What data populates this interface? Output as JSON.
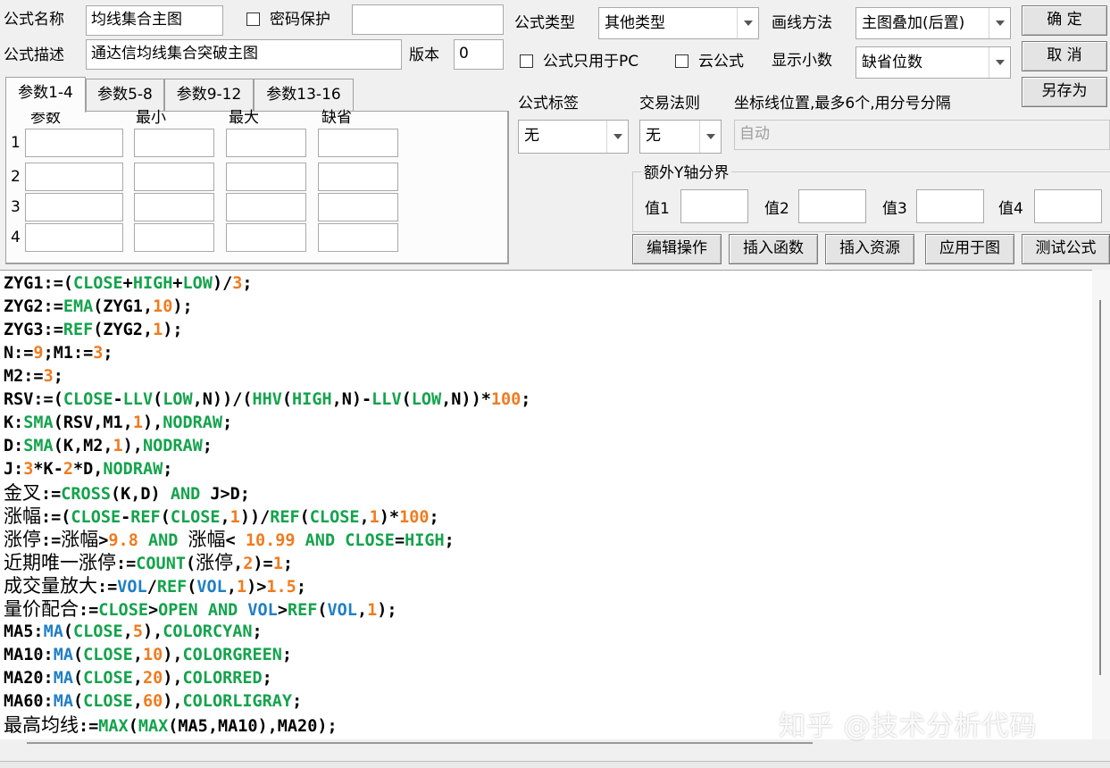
{
  "header": {
    "formula_name_label": "公式名称",
    "formula_name_value": "均线集合主图",
    "password_label": "密码保护",
    "formula_desc_label": "公式描述",
    "formula_desc_value": "通达信均线集合突破主图",
    "version_label": "版本",
    "version_value": "0",
    "formula_type_label": "公式类型",
    "formula_type_value": "其他类型",
    "draw_method_label": "画线方法",
    "draw_method_value": "主图叠加(后置)",
    "pc_only_label": "公式只用于PC",
    "cloud_label": "云公式",
    "decimals_label": "显示小数",
    "decimals_value": "缺省位数"
  },
  "buttons": {
    "ok": "确  定",
    "cancel": "取  消",
    "save_as": "另存为",
    "edit_ops": "编辑操作",
    "insert_func": "插入函数",
    "insert_res": "插入资源",
    "apply": "应用于图",
    "test": "测试公式"
  },
  "tabs": [
    "参数1-4",
    "参数5-8",
    "参数9-12",
    "参数13-16"
  ],
  "params": {
    "col_param": "参数",
    "col_min": "最小",
    "col_max": "最大",
    "col_default": "缺省",
    "rows": [
      "1",
      "2",
      "3",
      "4"
    ]
  },
  "right_panel": {
    "tag_label": "公式标签",
    "tag_value": "无",
    "rule_label": "交易法则",
    "rule_value": "无",
    "coord_label": "坐标线位置,最多6个,用分号分隔",
    "coord_value": "自动",
    "y_axis_group": "额外Y轴分界",
    "v1": "值1",
    "v2": "值2",
    "v3": "值3",
    "v4": "值4"
  },
  "code_lines": [
    [
      [
        "t",
        "ZYG1:=("
      ],
      [
        "f",
        "CLOSE"
      ],
      [
        "t",
        "+"
      ],
      [
        "f",
        "HIGH"
      ],
      [
        "t",
        "+"
      ],
      [
        "f",
        "LOW"
      ],
      [
        "t",
        ")/"
      ],
      [
        "n",
        "3"
      ],
      [
        "t",
        ";"
      ]
    ],
    [
      [
        "t",
        "ZYG2:="
      ],
      [
        "f",
        "EMA"
      ],
      [
        "t",
        "(ZYG1,"
      ],
      [
        "n",
        "10"
      ],
      [
        "t",
        ");"
      ]
    ],
    [
      [
        "t",
        "ZYG3:="
      ],
      [
        "f",
        "REF"
      ],
      [
        "t",
        "(ZYG2,"
      ],
      [
        "n",
        "1"
      ],
      [
        "t",
        ");"
      ]
    ],
    [
      [
        "t",
        "N:="
      ],
      [
        "n",
        "9"
      ],
      [
        "t",
        ";M1:="
      ],
      [
        "n",
        "3"
      ],
      [
        "t",
        ";"
      ]
    ],
    [
      [
        "t",
        "M2:="
      ],
      [
        "n",
        "3"
      ],
      [
        "t",
        ";"
      ]
    ],
    [
      [
        "t",
        "RSV:=("
      ],
      [
        "f",
        "CLOSE"
      ],
      [
        "t",
        "-"
      ],
      [
        "f",
        "LLV"
      ],
      [
        "t",
        "("
      ],
      [
        "f",
        "LOW"
      ],
      [
        "t",
        ",N))/("
      ],
      [
        "f",
        "HHV"
      ],
      [
        "t",
        "("
      ],
      [
        "f",
        "HIGH"
      ],
      [
        "t",
        ",N)-"
      ],
      [
        "f",
        "LLV"
      ],
      [
        "t",
        "("
      ],
      [
        "f",
        "LOW"
      ],
      [
        "t",
        ",N))*"
      ],
      [
        "n",
        "100"
      ],
      [
        "t",
        ";"
      ]
    ],
    [
      [
        "t",
        "K:"
      ],
      [
        "f",
        "SMA"
      ],
      [
        "t",
        "(RSV,M1,"
      ],
      [
        "n",
        "1"
      ],
      [
        "t",
        "),"
      ],
      [
        "f",
        "NODRAW"
      ],
      [
        "t",
        ";"
      ]
    ],
    [
      [
        "t",
        "D:"
      ],
      [
        "f",
        "SMA"
      ],
      [
        "t",
        "(K,M2,"
      ],
      [
        "n",
        "1"
      ],
      [
        "t",
        "),"
      ],
      [
        "f",
        "NODRAW"
      ],
      [
        "t",
        ";"
      ]
    ],
    [
      [
        "t",
        "J:"
      ],
      [
        "n",
        "3"
      ],
      [
        "t",
        "*K-"
      ],
      [
        "n",
        "2"
      ],
      [
        "t",
        "*D,"
      ],
      [
        "f",
        "NODRAW"
      ],
      [
        "t",
        ";"
      ]
    ],
    [
      [
        "c",
        "金叉"
      ],
      [
        "t",
        ":="
      ],
      [
        "f",
        "CROSS"
      ],
      [
        "t",
        "(K,D) "
      ],
      [
        "f",
        "AND"
      ],
      [
        "t",
        " J>D;"
      ]
    ],
    [
      [
        "c",
        "涨幅"
      ],
      [
        "t",
        ":=("
      ],
      [
        "f",
        "CLOSE"
      ],
      [
        "t",
        "-"
      ],
      [
        "f",
        "REF"
      ],
      [
        "t",
        "("
      ],
      [
        "f",
        "CLOSE"
      ],
      [
        "t",
        ","
      ],
      [
        "n",
        "1"
      ],
      [
        "t",
        "))/"
      ],
      [
        "f",
        "REF"
      ],
      [
        "t",
        "("
      ],
      [
        "f",
        "CLOSE"
      ],
      [
        "t",
        ","
      ],
      [
        "n",
        "1"
      ],
      [
        "t",
        ")*"
      ],
      [
        "n",
        "100"
      ],
      [
        "t",
        ";"
      ]
    ],
    [
      [
        "c",
        "涨停"
      ],
      [
        "t",
        ":="
      ],
      [
        "c",
        "涨幅"
      ],
      [
        "t",
        ">"
      ],
      [
        "n",
        "9.8"
      ],
      [
        "t",
        " "
      ],
      [
        "f",
        "AND"
      ],
      [
        "t",
        " "
      ],
      [
        "c",
        "涨幅"
      ],
      [
        "t",
        "< "
      ],
      [
        "n",
        "10.99"
      ],
      [
        "t",
        " "
      ],
      [
        "f",
        "AND"
      ],
      [
        "t",
        " "
      ],
      [
        "f",
        "CLOSE"
      ],
      [
        "t",
        "="
      ],
      [
        "f",
        "HIGH"
      ],
      [
        "t",
        ";"
      ]
    ],
    [
      [
        "c",
        "近期唯一涨停"
      ],
      [
        "t",
        ":="
      ],
      [
        "f",
        "COUNT"
      ],
      [
        "t",
        "("
      ],
      [
        "c",
        "涨停"
      ],
      [
        "t",
        ","
      ],
      [
        "n",
        "2"
      ],
      [
        "t",
        ")="
      ],
      [
        "n",
        "1"
      ],
      [
        "t",
        ";"
      ]
    ],
    [
      [
        "c",
        "成交量放大"
      ],
      [
        "t",
        ":="
      ],
      [
        "b",
        "VOL"
      ],
      [
        "t",
        "/"
      ],
      [
        "f",
        "REF"
      ],
      [
        "t",
        "("
      ],
      [
        "b",
        "VOL"
      ],
      [
        "t",
        ","
      ],
      [
        "n",
        "1"
      ],
      [
        "t",
        ")>"
      ],
      [
        "n",
        "1.5"
      ],
      [
        "t",
        ";"
      ]
    ],
    [
      [
        "c",
        "量价配合"
      ],
      [
        "t",
        ":="
      ],
      [
        "f",
        "CLOSE"
      ],
      [
        "t",
        ">"
      ],
      [
        "f",
        "OPEN"
      ],
      [
        "t",
        " "
      ],
      [
        "f",
        "AND"
      ],
      [
        "t",
        " "
      ],
      [
        "b",
        "VOL"
      ],
      [
        "t",
        ">"
      ],
      [
        "f",
        "REF"
      ],
      [
        "t",
        "("
      ],
      [
        "b",
        "VOL"
      ],
      [
        "t",
        ","
      ],
      [
        "n",
        "1"
      ],
      [
        "t",
        ");"
      ]
    ],
    [
      [
        "t",
        "MA5:"
      ],
      [
        "b",
        "MA"
      ],
      [
        "t",
        "("
      ],
      [
        "f",
        "CLOSE"
      ],
      [
        "t",
        ","
      ],
      [
        "n",
        "5"
      ],
      [
        "t",
        "),"
      ],
      [
        "f",
        "COLORCYAN"
      ],
      [
        "t",
        ";"
      ]
    ],
    [
      [
        "t",
        "MA10:"
      ],
      [
        "b",
        "MA"
      ],
      [
        "t",
        "("
      ],
      [
        "f",
        "CLOSE"
      ],
      [
        "t",
        ","
      ],
      [
        "n",
        "10"
      ],
      [
        "t",
        "),"
      ],
      [
        "f",
        "COLORGREEN"
      ],
      [
        "t",
        ";"
      ]
    ],
    [
      [
        "t",
        "MA20:"
      ],
      [
        "b",
        "MA"
      ],
      [
        "t",
        "("
      ],
      [
        "f",
        "CLOSE"
      ],
      [
        "t",
        ","
      ],
      [
        "n",
        "20"
      ],
      [
        "t",
        "),"
      ],
      [
        "f",
        "COLORRED"
      ],
      [
        "t",
        ";"
      ]
    ],
    [
      [
        "t",
        "MA60:"
      ],
      [
        "b",
        "MA"
      ],
      [
        "t",
        "("
      ],
      [
        "f",
        "CLOSE"
      ],
      [
        "t",
        ","
      ],
      [
        "n",
        "60"
      ],
      [
        "t",
        "),"
      ],
      [
        "f",
        "COLORLIGRAY"
      ],
      [
        "t",
        ";"
      ]
    ],
    [
      [
        "c",
        "最高均线"
      ],
      [
        "t",
        ":="
      ],
      [
        "f",
        "MAX"
      ],
      [
        "t",
        "("
      ],
      [
        "f",
        "MAX"
      ],
      [
        "t",
        "(MA5,MA10),MA20);"
      ]
    ]
  ],
  "watermark": "知乎 @技术分析代码"
}
